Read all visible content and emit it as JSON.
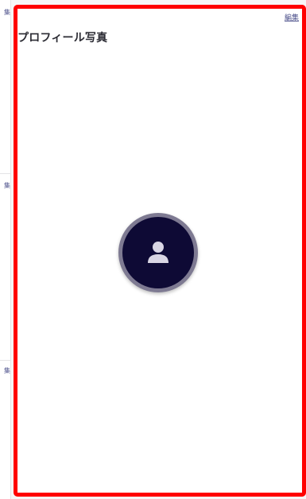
{
  "left_column": {
    "edit_labels": [
      "集",
      "集",
      "集"
    ]
  },
  "card": {
    "edit_label": "編集",
    "title": "プロフィール写真",
    "avatar_icon": "user-icon",
    "highlight_color": "#ff0000",
    "avatar_bg": "#0e0a35"
  }
}
